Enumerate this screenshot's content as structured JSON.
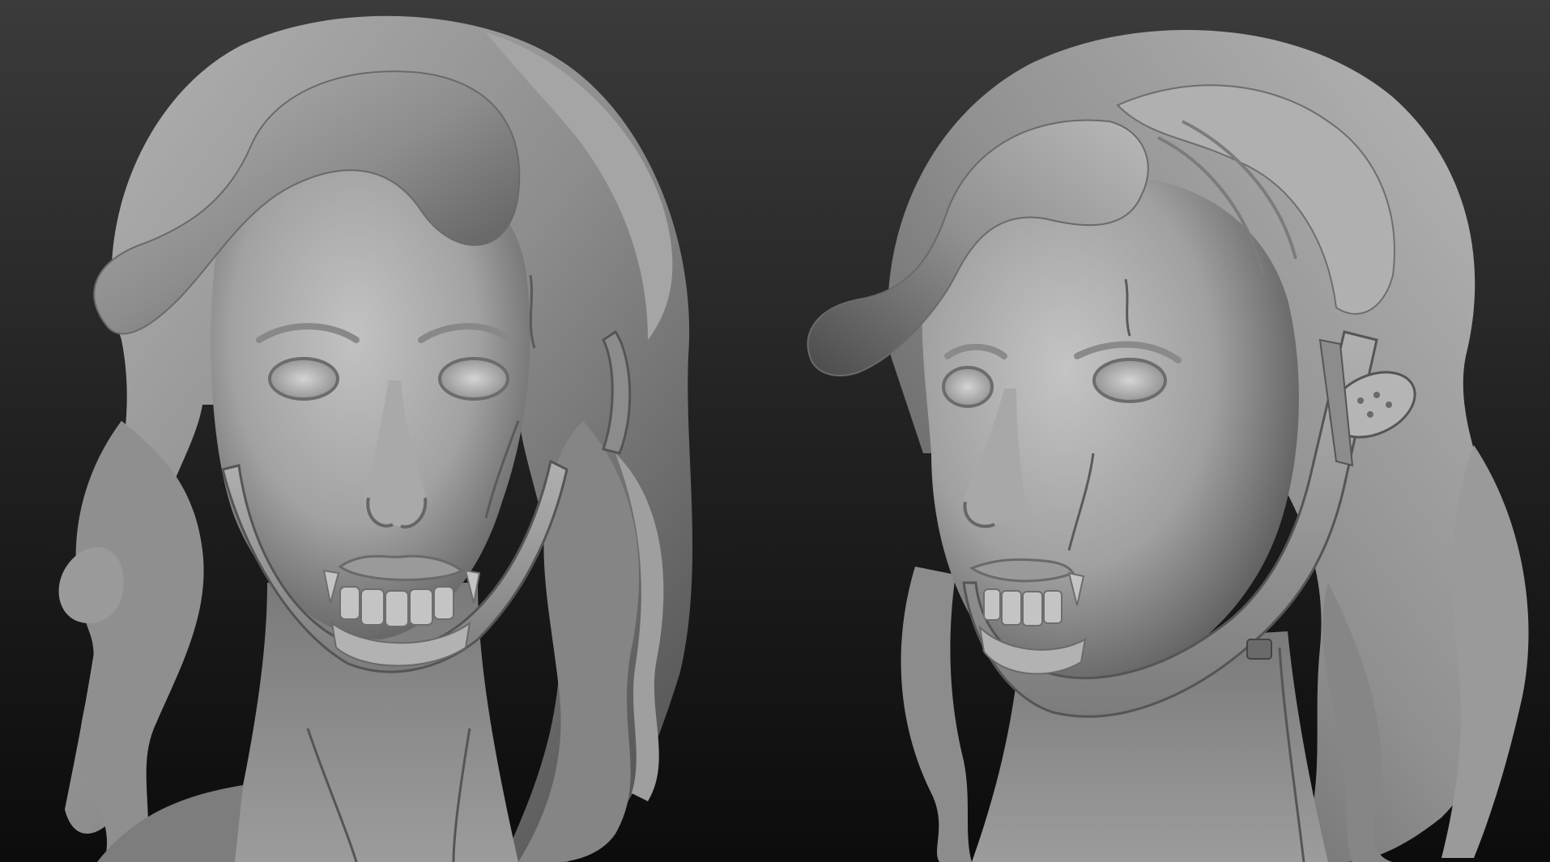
{
  "scene": {
    "background_top": "#3a3a3a",
    "background_bottom": "#0e0e0e",
    "clay_light": "#bdbdbd",
    "clay_mid": "#8a8a8a",
    "clay_dark": "#4a4a4a"
  },
  "views": [
    {
      "name": "front-view",
      "kind": "sculpt bust",
      "angle": "front"
    },
    {
      "name": "three-quarter-view",
      "kind": "sculpt bust",
      "angle": "three-quarter"
    }
  ]
}
